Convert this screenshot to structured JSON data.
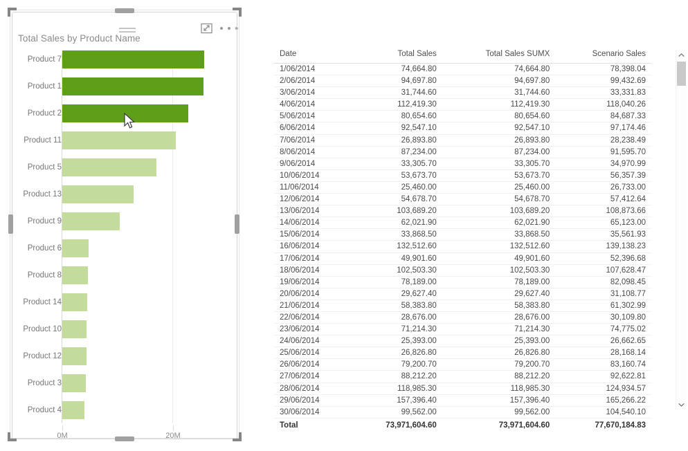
{
  "visual": {
    "title": "Total Sales by Product Name",
    "icons": {
      "drag_grip": "drag-grip-icon",
      "focus_mode": "focus-mode-icon",
      "more_options": "more-options-icon"
    }
  },
  "colors": {
    "bar_dark_green": "#5f9e18",
    "bar_light_green": "#c3db9b",
    "axis_line": "#d9d9d9",
    "title_text": "#8a8a8a",
    "table_text": "#4a4a4a"
  },
  "chart_data": {
    "type": "bar",
    "orientation": "horizontal",
    "title": "Total Sales by Product Name",
    "xlabel": "",
    "ylabel": "",
    "xlim": [
      0,
      26
    ],
    "tick_labels": [
      "0M",
      "20M"
    ],
    "tick_values": [
      0,
      20
    ],
    "grid": false,
    "unit": "M",
    "categories": [
      "Product 7",
      "Product 1",
      "Product 2",
      "Product 11",
      "Product 5",
      "Product 13",
      "Product 9",
      "Product 6",
      "Product 8",
      "Product 14",
      "Product 10",
      "Product 12",
      "Product 3",
      "Product 4"
    ],
    "values": [
      25.6,
      25.5,
      22.7,
      20.5,
      17.0,
      12.9,
      10.4,
      4.8,
      4.6,
      4.5,
      4.4,
      4.4,
      4.2,
      4.0
    ],
    "bar_colors": [
      "#5f9e18",
      "#5f9e18",
      "#5f9e18",
      "#c3db9b",
      "#c3db9b",
      "#c3db9b",
      "#c3db9b",
      "#c3db9b",
      "#c3db9b",
      "#c3db9b",
      "#c3db9b",
      "#c3db9b",
      "#c3db9b",
      "#c3db9b"
    ]
  },
  "table": {
    "columns": [
      "Date",
      "Total Sales",
      "Total Sales SUMX",
      "Scenario Sales"
    ],
    "rows": [
      [
        "1/06/2014",
        "74,664.80",
        "74,664.80",
        "78,398.04"
      ],
      [
        "2/06/2014",
        "94,697.80",
        "94,697.80",
        "99,432.69"
      ],
      [
        "3/06/2014",
        "31,744.60",
        "31,744.60",
        "33,331.83"
      ],
      [
        "4/06/2014",
        "112,419.30",
        "112,419.30",
        "118,040.26"
      ],
      [
        "5/06/2014",
        "80,654.60",
        "80,654.60",
        "84,687.33"
      ],
      [
        "6/06/2014",
        "92,547.10",
        "92,547.10",
        "97,174.46"
      ],
      [
        "7/06/2014",
        "26,893.80",
        "26,893.80",
        "28,238.49"
      ],
      [
        "8/06/2014",
        "87,234.00",
        "87,234.00",
        "91,595.70"
      ],
      [
        "9/06/2014",
        "33,305.70",
        "33,305.70",
        "34,970.99"
      ],
      [
        "10/06/2014",
        "53,673.70",
        "53,673.70",
        "56,357.39"
      ],
      [
        "11/06/2014",
        "25,460.00",
        "25,460.00",
        "26,733.00"
      ],
      [
        "12/06/2014",
        "54,678.70",
        "54,678.70",
        "57,412.64"
      ],
      [
        "13/06/2014",
        "103,689.20",
        "103,689.20",
        "108,873.66"
      ],
      [
        "14/06/2014",
        "62,021.90",
        "62,021.90",
        "65,123.00"
      ],
      [
        "15/06/2014",
        "33,868.50",
        "33,868.50",
        "35,561.93"
      ],
      [
        "16/06/2014",
        "132,512.60",
        "132,512.60",
        "139,138.23"
      ],
      [
        "17/06/2014",
        "49,901.60",
        "49,901.60",
        "52,396.68"
      ],
      [
        "18/06/2014",
        "102,503.30",
        "102,503.30",
        "107,628.47"
      ],
      [
        "19/06/2014",
        "78,189.00",
        "78,189.00",
        "82,098.45"
      ],
      [
        "20/06/2014",
        "29,627.40",
        "29,627.40",
        "31,108.77"
      ],
      [
        "21/06/2014",
        "58,383.80",
        "58,383.80",
        "61,302.99"
      ],
      [
        "22/06/2014",
        "28,676.00",
        "28,676.00",
        "30,109.80"
      ],
      [
        "23/06/2014",
        "71,214.30",
        "71,214.30",
        "74,775.02"
      ],
      [
        "24/06/2014",
        "25,393.00",
        "25,393.00",
        "26,662.65"
      ],
      [
        "25/06/2014",
        "26,826.80",
        "26,826.80",
        "28,168.14"
      ],
      [
        "26/06/2014",
        "79,200.70",
        "79,200.70",
        "83,160.74"
      ],
      [
        "27/06/2014",
        "88,212.20",
        "88,212.20",
        "92,622.81"
      ],
      [
        "28/06/2014",
        "118,985.30",
        "118,985.30",
        "124,934.57"
      ],
      [
        "29/06/2014",
        "157,396.40",
        "157,396.40",
        "165,266.22"
      ],
      [
        "30/06/2014",
        "99,562.00",
        "99,562.00",
        "104,540.10"
      ]
    ],
    "total_row": [
      "Total",
      "73,971,604.60",
      "73,971,604.60",
      "77,670,184.83"
    ]
  },
  "scrollbar": {
    "up_arrow": "chevron-up-icon",
    "down_arrow": "chevron-down-icon"
  }
}
